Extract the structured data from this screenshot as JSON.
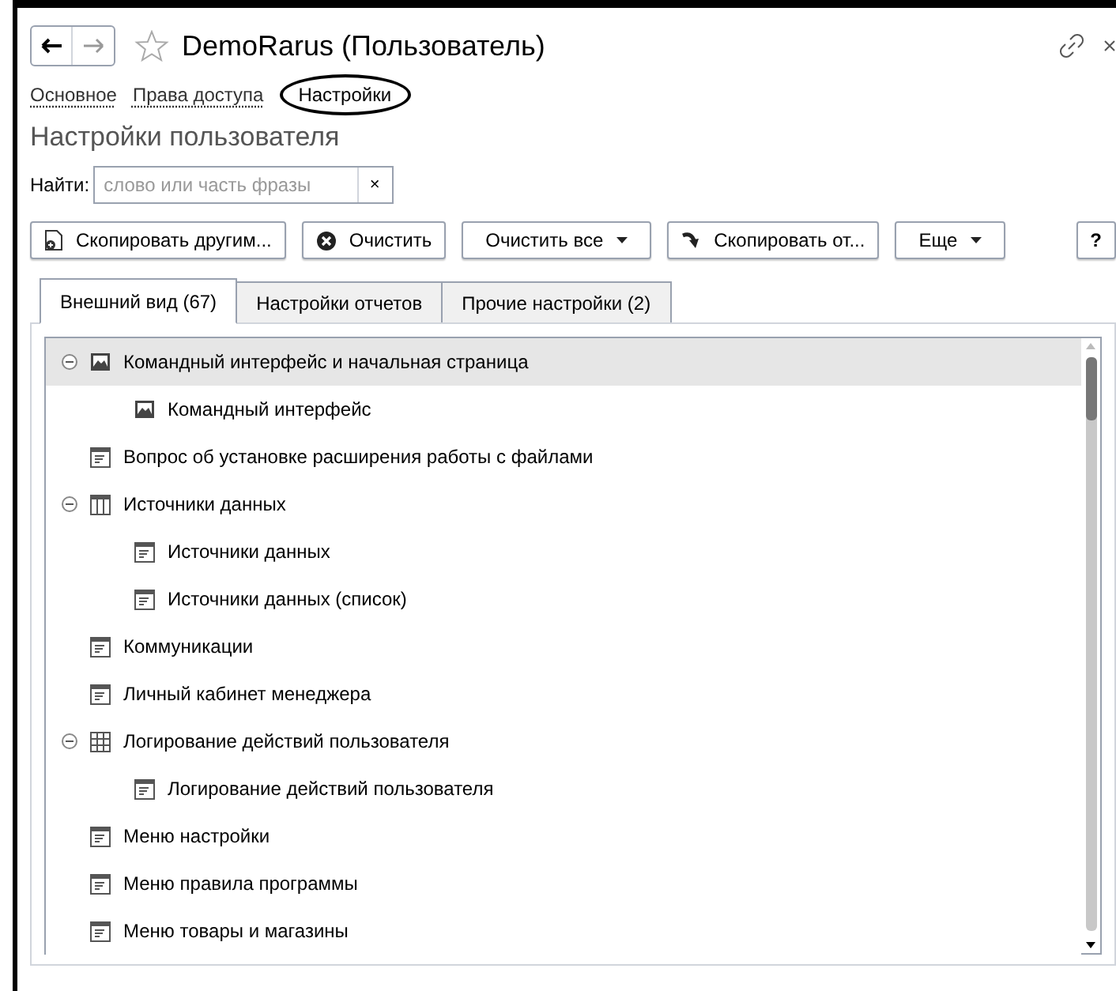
{
  "window": {
    "title": "DemoRarus (Пользователь)"
  },
  "sections": [
    {
      "label": "Основное",
      "selected": false
    },
    {
      "label": "Права доступа",
      "selected": false
    },
    {
      "label": "Настройки",
      "selected": true
    }
  ],
  "heading": "Настройки пользователя",
  "search": {
    "label": "Найти:",
    "placeholder": "слово или часть фразы",
    "clear": "×"
  },
  "toolbar": [
    {
      "label": "Скопировать другим...",
      "kind": "copy",
      "dropdown": false
    },
    {
      "label": "Очистить",
      "kind": "clear",
      "dropdown": false
    },
    {
      "label": "Очистить все",
      "kind": "plain",
      "dropdown": true
    },
    {
      "label": "Скопировать от...",
      "kind": "arrow",
      "dropdown": false
    },
    {
      "label": "Еще",
      "kind": "plain",
      "dropdown": true
    },
    {
      "label": "?",
      "kind": "help",
      "dropdown": false
    }
  ],
  "tabs": [
    {
      "label": "Внешний вид (67)",
      "selected": true
    },
    {
      "label": "Настройки отчетов",
      "selected": false
    },
    {
      "label": "Прочие настройки (2)",
      "selected": false
    }
  ],
  "tree": [
    {
      "label": "Командный интерфейс и начальная страница",
      "kind": "picture",
      "selected": true,
      "expanded": true,
      "children": [
        {
          "label": "Командный интерфейс",
          "kind": "picture",
          "selected": false
        }
      ]
    },
    {
      "label": "Вопрос об установке расширения работы с файлами",
      "kind": "form",
      "selected": false
    },
    {
      "label": "Источники данных",
      "kind": "table",
      "selected": false,
      "expanded": true,
      "children": [
        {
          "label": "Источники данных",
          "kind": "form",
          "selected": false
        },
        {
          "label": "Источники данных (список)",
          "kind": "form",
          "selected": false
        }
      ]
    },
    {
      "label": "Коммуникации",
      "kind": "form",
      "selected": false
    },
    {
      "label": "Личный кабинет менеджера",
      "kind": "form",
      "selected": false
    },
    {
      "label": "Логирование действий пользователя",
      "kind": "grid",
      "selected": false,
      "expanded": true,
      "children": [
        {
          "label": "Логирование действий пользователя",
          "kind": "form",
          "selected": false
        }
      ]
    },
    {
      "label": "Меню настройки",
      "kind": "form",
      "selected": false
    },
    {
      "label": "Меню правила программы",
      "kind": "form",
      "selected": false
    },
    {
      "label": "Меню товары и магазины",
      "kind": "form",
      "selected": false
    }
  ]
}
